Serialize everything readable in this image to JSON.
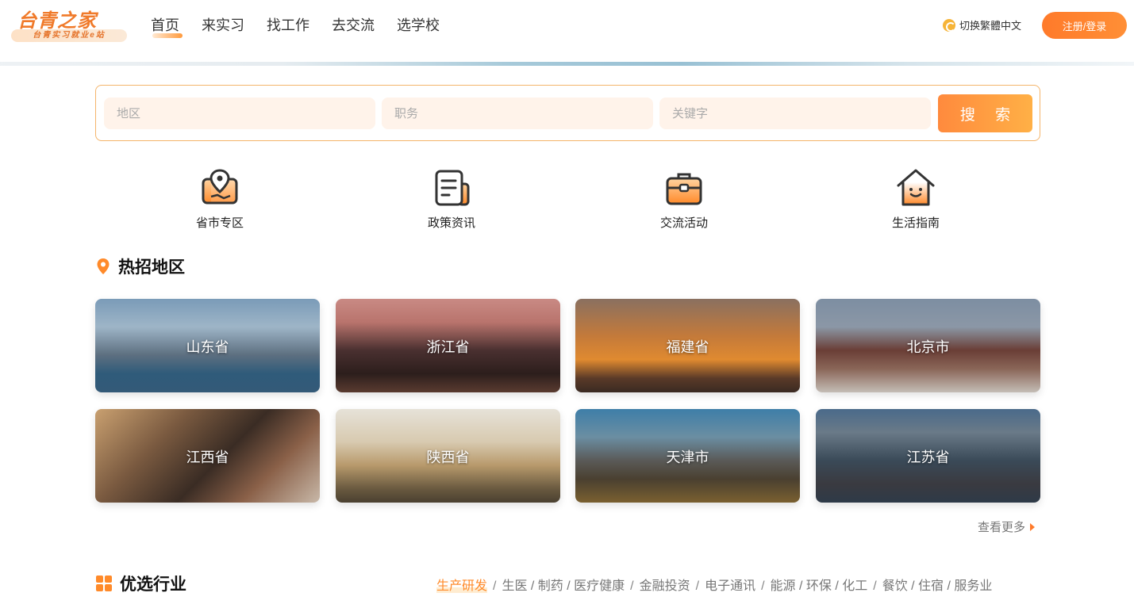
{
  "header": {
    "logo_title": "台青之家",
    "logo_subtitle": "台青实习就业e站",
    "nav": [
      {
        "label": "首页",
        "active": true
      },
      {
        "label": "来实习",
        "active": false
      },
      {
        "label": "找工作",
        "active": false
      },
      {
        "label": "去交流",
        "active": false
      },
      {
        "label": "选学校",
        "active": false
      }
    ],
    "lang_switch": "切换繁體中文",
    "login_label": "注册/登录"
  },
  "search": {
    "region_placeholder": "地区",
    "position_placeholder": "职务",
    "keyword_placeholder": "关键字",
    "button_label": "搜 索"
  },
  "quick_links": [
    {
      "label": "省市专区",
      "icon": "map-icon"
    },
    {
      "label": "政策资讯",
      "icon": "document-icon"
    },
    {
      "label": "交流活动",
      "icon": "briefcase-icon"
    },
    {
      "label": "生活指南",
      "icon": "home-icon"
    }
  ],
  "hot_regions": {
    "title": "热招地区",
    "items": [
      "山东省",
      "浙江省",
      "福建省",
      "北京市",
      "江西省",
      "陕西省",
      "天津市",
      "江苏省"
    ],
    "more_label": "查看更多"
  },
  "industries": {
    "title": "优选行业",
    "items": [
      "生产研发",
      "生医 / 制药 / 医疗健康",
      "金融投资",
      "电子通讯",
      "能源 / 环保 / 化工",
      "餐饮 / 住宿 / 服务业"
    ],
    "active_index": 0
  },
  "colors": {
    "accent": "#ff8a2a",
    "search_bg": "#fff3ea",
    "search_border": "#f4b46a"
  }
}
